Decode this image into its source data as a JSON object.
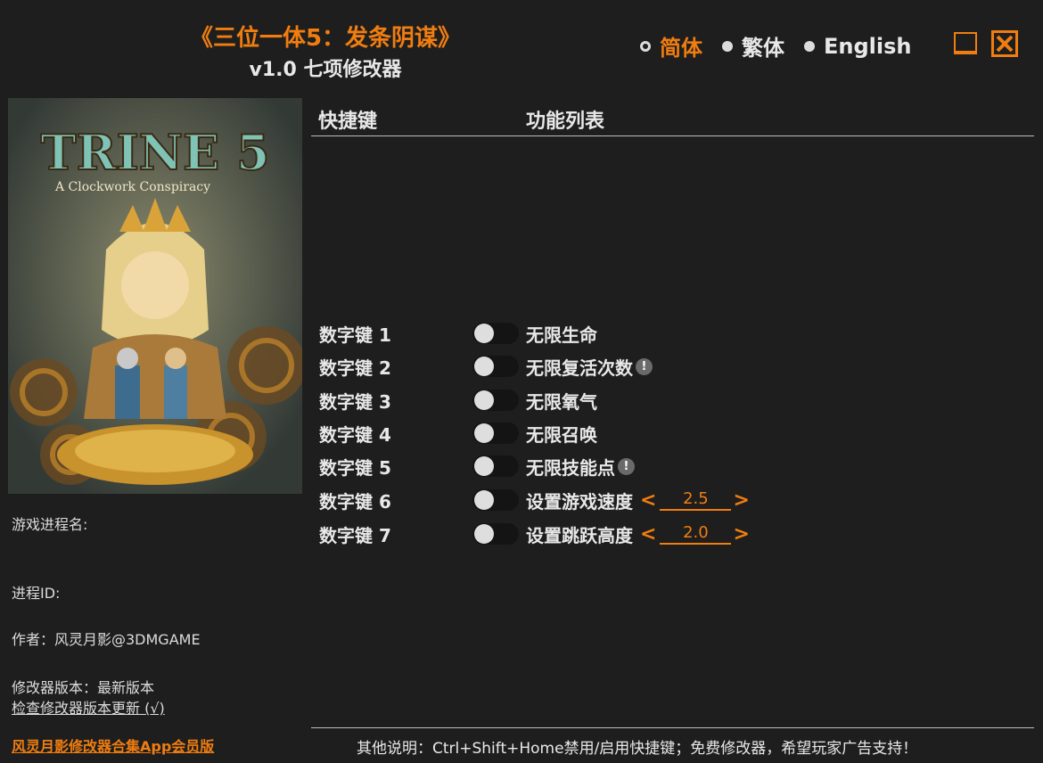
{
  "header": {
    "title": "《三位一体5：发条阴谋》",
    "subtitle": "v1.0 七项修改器"
  },
  "languages": [
    {
      "label": "简体",
      "selected": true
    },
    {
      "label": "繁体",
      "selected": false
    },
    {
      "label": "English",
      "selected": false
    }
  ],
  "cover": {
    "logo_text": "TRINE 5",
    "logo_subtitle": "A Clockwork Conspiracy"
  },
  "info": {
    "process_name_label": "游戏进程名:",
    "process_id_label": "进程ID:",
    "author": "作者：风灵月影@3DMGAME",
    "version": "修改器版本：最新版本",
    "check_update": "检查修改器版本更新 (√)",
    "promo": "风灵月影修改器合集App会员版"
  },
  "table": {
    "col_hotkey": "快捷键",
    "col_feature": "功能列表"
  },
  "cheats": [
    {
      "hotkey": "数字键 1",
      "label": "无限生命",
      "enabled": false
    },
    {
      "hotkey": "数字键 2",
      "label": "无限复活次数",
      "enabled": false,
      "warn": "!"
    },
    {
      "hotkey": "数字键 3",
      "label": "无限氧气",
      "enabled": false
    },
    {
      "hotkey": "数字键 4",
      "label": "无限召唤",
      "enabled": false
    },
    {
      "hotkey": "数字键 5",
      "label": "无限技能点",
      "enabled": false,
      "warn": "!"
    },
    {
      "hotkey": "数字键 6",
      "label": "设置游戏速度",
      "enabled": false,
      "value": "2.5"
    },
    {
      "hotkey": "数字键 7",
      "label": "设置跳跃高度",
      "enabled": false,
      "value": "2.0"
    }
  ],
  "arrows": {
    "left": "<",
    "right": ">"
  },
  "footer": "其他说明：Ctrl+Shift+Home禁用/启用快捷键；免费修改器，希望玩家广告支持！",
  "colors": {
    "accent": "#f07d10",
    "background": "#1e1e1e",
    "text": "#e8e8e8"
  }
}
